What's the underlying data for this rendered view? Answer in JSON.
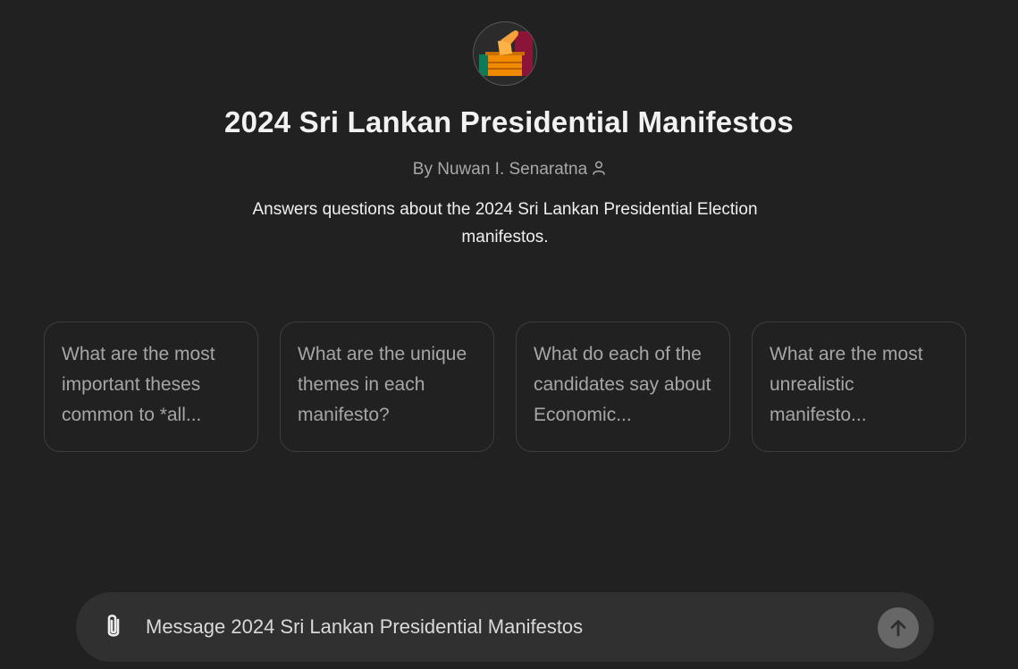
{
  "gpt": {
    "title": "2024 Sri Lankan Presidential Manifestos",
    "byline": "By Nuwan I. Senaratna",
    "description": "Answers questions about the 2024 Sri Lankan Presidential Election manifestos.",
    "avatar_icon": "ballot-box-icon",
    "author_icon": "person-icon"
  },
  "starters": [
    {
      "text": "What are the most important theses common to *all..."
    },
    {
      "text": "What are the unique themes in each manifesto?"
    },
    {
      "text": "What do each of the candidates say about Economic..."
    },
    {
      "text": "What are the most unrealistic manifesto..."
    }
  ],
  "composer": {
    "placeholder": "Message 2024 Sri Lankan Presidential Manifestos",
    "attach_icon": "paperclip-icon",
    "send_icon": "arrow-up-icon"
  },
  "colors": {
    "background": "#212121",
    "composer": "#303030",
    "send_button": "#676767",
    "avatar_orange": "#f08a00",
    "avatar_maroon": "#8a1538",
    "avatar_green": "#0e7a5a"
  }
}
